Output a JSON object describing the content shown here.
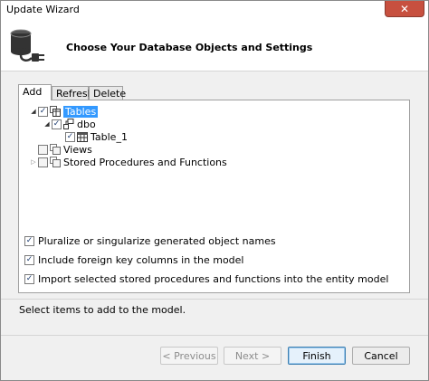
{
  "window": {
    "title": "Update Wizard",
    "close_label": "✕"
  },
  "header": {
    "heading": "Choose Your Database Objects and Settings"
  },
  "tabs": [
    {
      "label": "Add"
    },
    {
      "label": "Refresh"
    },
    {
      "label": "Delete"
    }
  ],
  "tree": {
    "tables": "Tables",
    "dbo": "dbo",
    "table_1": "Table_1",
    "views": "Views",
    "stored_procedures": "Stored Procedures and Functions"
  },
  "options": {
    "pluralize": "Pluralize or singularize generated object names",
    "foreign_keys": "Include foreign key columns in the model",
    "import_procs": "Import selected stored procedures and functions into the entity model"
  },
  "status": "Select items to add to the model.",
  "buttons": {
    "previous": "< Previous",
    "next": "Next >",
    "finish": "Finish",
    "cancel": "Cancel"
  },
  "colors": {
    "selection": "#3399ff",
    "close_button": "#c7503f",
    "default_button_border": "#3c7fb1"
  }
}
